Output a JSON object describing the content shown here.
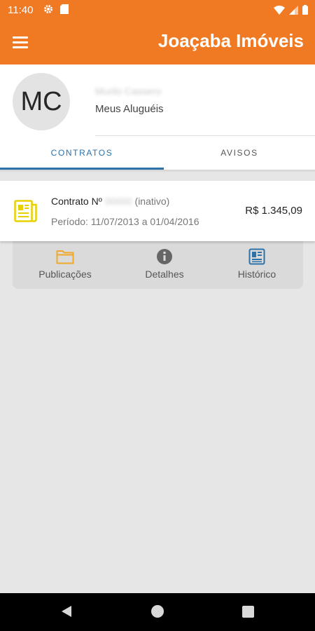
{
  "status_bar": {
    "time": "11:40"
  },
  "app_bar": {
    "title": "Joaçaba Imóveis"
  },
  "profile": {
    "initials": "MC",
    "name": "Murilo Cassero",
    "subtitle": "Meus Aluguéis"
  },
  "tabs": [
    {
      "label": "CONTRATOS",
      "active": true
    },
    {
      "label": "AVISOS",
      "active": false
    }
  ],
  "contract": {
    "label": "Contrato Nº",
    "number": "00000",
    "status": "(inativo)",
    "period": "Período: 11/07/2013 a 01/04/2016",
    "value": "R$ 1.345,09"
  },
  "actions": [
    {
      "label": "Publicações",
      "icon": "folder-icon",
      "color": "#f0a82a"
    },
    {
      "label": "Detalhes",
      "icon": "info-icon",
      "color": "#666666"
    },
    {
      "label": "Histórico",
      "icon": "document-list-icon",
      "color": "#2c71a8"
    }
  ],
  "colors": {
    "primary": "#f07a23",
    "accent": "#2c71a8",
    "doc_icon": "#e9d000"
  }
}
